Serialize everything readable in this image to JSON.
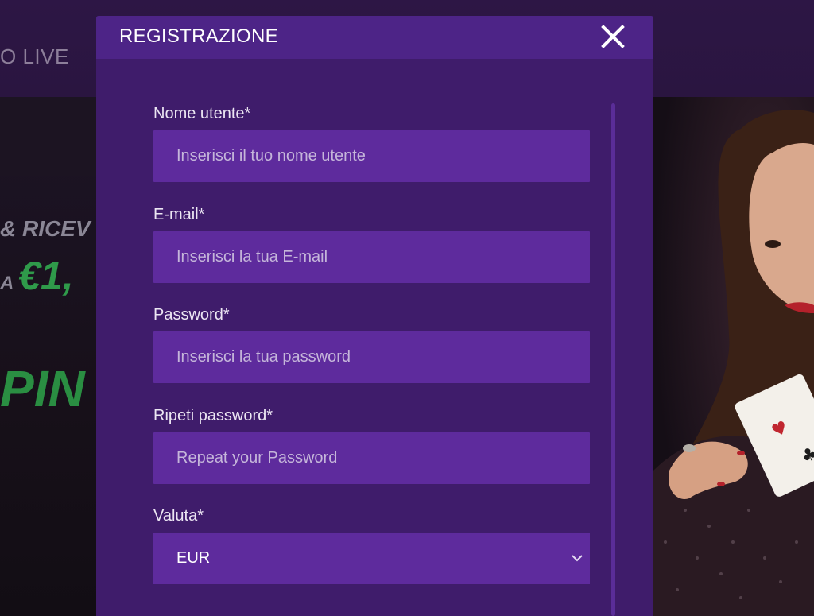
{
  "background": {
    "nav_item": "O LIVE",
    "promo_line_1": "& RICEV",
    "promo_line_2_prefix": "A",
    "promo_amount": "€1,",
    "promo_line_3": "PIN"
  },
  "modal": {
    "title": "REGISTRAZIONE",
    "close_icon": "close-icon",
    "fields": {
      "username": {
        "label": "Nome utente*",
        "placeholder": "Inserisci il tuo nome utente",
        "value": ""
      },
      "email": {
        "label": "E-mail*",
        "placeholder": "Inserisci la tua E-mail",
        "value": ""
      },
      "password": {
        "label": "Password*",
        "placeholder": "Inserisci la tua password",
        "value": ""
      },
      "repeat_password": {
        "label": "Ripeti password*",
        "placeholder": "Repeat your Password",
        "value": ""
      },
      "currency": {
        "label": "Valuta*",
        "selected": "EUR",
        "chevron_icon": "chevron-down-icon"
      }
    }
  },
  "colors": {
    "modal_bg": "#3f1c6b",
    "modal_header_bg": "#4d2487",
    "input_bg": "#5e2b9d",
    "promo_green": "#2f9a4a"
  }
}
